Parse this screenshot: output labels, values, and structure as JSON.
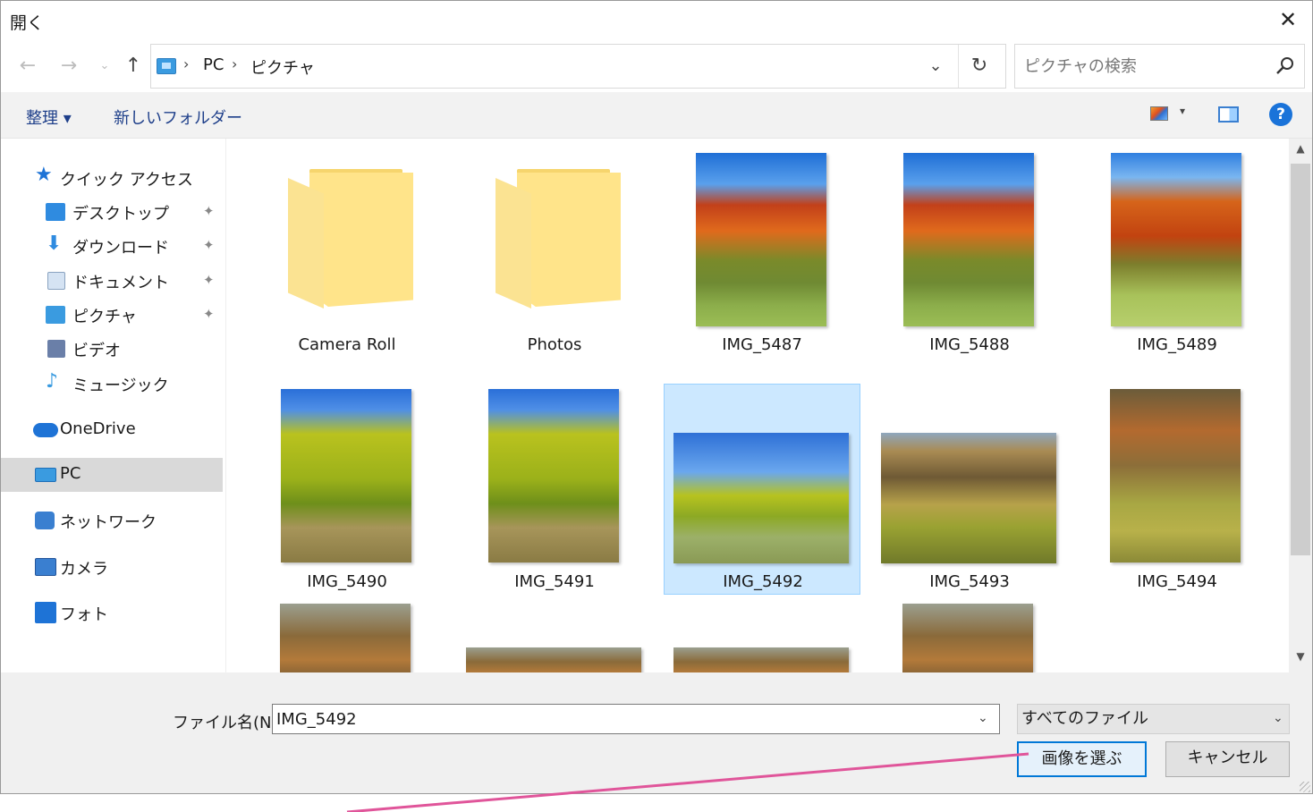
{
  "window": {
    "title": "開く",
    "close_symbol": "✕"
  },
  "nav": {
    "back_symbol": "←",
    "forward_symbol": "→",
    "recent_symbol": "⌄",
    "up_symbol": "↑",
    "breadcrumb": [
      "PC",
      "ピクチャ"
    ],
    "breadcrumb_sep": "›",
    "dropdown_symbol": "⌄",
    "refresh_symbol": "↻",
    "search_placeholder": "ピクチャの検索"
  },
  "toolbar": {
    "organize": "整理 ▾",
    "new_folder": "新しいフォルダー",
    "view_caret": "▾",
    "help_symbol": "?"
  },
  "sidebar": {
    "items": [
      {
        "label": "クイック アクセス",
        "icon": "star-icon",
        "color": "#1e73d6"
      },
      {
        "label": "デスクトップ",
        "icon": "desktop-icon",
        "color": "#2f8be0",
        "pinned": true
      },
      {
        "label": "ダウンロード",
        "icon": "download-icon",
        "color": "#2f8be0",
        "pinned": true
      },
      {
        "label": "ドキュメント",
        "icon": "documents-icon",
        "color": "#8aa3c0",
        "pinned": true
      },
      {
        "label": "ピクチャ",
        "icon": "pictures-icon",
        "color": "#3a9be0",
        "pinned": true
      },
      {
        "label": "ビデオ",
        "icon": "videos-icon",
        "color": "#6a7fa8"
      },
      {
        "label": "ミュージック",
        "icon": "music-icon",
        "color": "#3a9be0"
      },
      {
        "label": "OneDrive",
        "icon": "onedrive-icon",
        "color": "#1e73d6"
      },
      {
        "label": "PC",
        "icon": "pc-icon",
        "color": "#3a9be0",
        "selected": true
      },
      {
        "label": "ネットワーク",
        "icon": "network-icon",
        "color": "#3a7fd0"
      },
      {
        "label": "カメラ",
        "icon": "camera-icon",
        "color": "#3a7fd0"
      },
      {
        "label": "フォト",
        "icon": "photos-icon",
        "color": "#1e73d6"
      }
    ],
    "pin_symbol": "📌"
  },
  "items": [
    {
      "name": "Camera Roll",
      "kind": "folder"
    },
    {
      "name": "Photos",
      "kind": "folder"
    },
    {
      "name": "IMG_5487",
      "kind": "image"
    },
    {
      "name": "IMG_5488",
      "kind": "image"
    },
    {
      "name": "IMG_5489",
      "kind": "image"
    },
    {
      "name": "IMG_5490",
      "kind": "image"
    },
    {
      "name": "IMG_5491",
      "kind": "image"
    },
    {
      "name": "IMG_5492",
      "kind": "image",
      "selected": true
    },
    {
      "name": "IMG_5493",
      "kind": "image"
    },
    {
      "name": "IMG_5494",
      "kind": "image"
    }
  ],
  "scroll": {
    "up_symbol": "▲",
    "down_symbol": "▼"
  },
  "footer": {
    "filename_label": "ファイル名(N):",
    "filename_value": "IMG_5492",
    "filename_caret": "⌄",
    "filter_value": "すべてのファイル",
    "filter_caret": "⌄",
    "open_button": "画像を選ぶ",
    "cancel_button": "キャンセル"
  },
  "colors": {
    "accent": "#0078d7",
    "selection": "#cce8ff",
    "annotation": "#e0559a"
  }
}
